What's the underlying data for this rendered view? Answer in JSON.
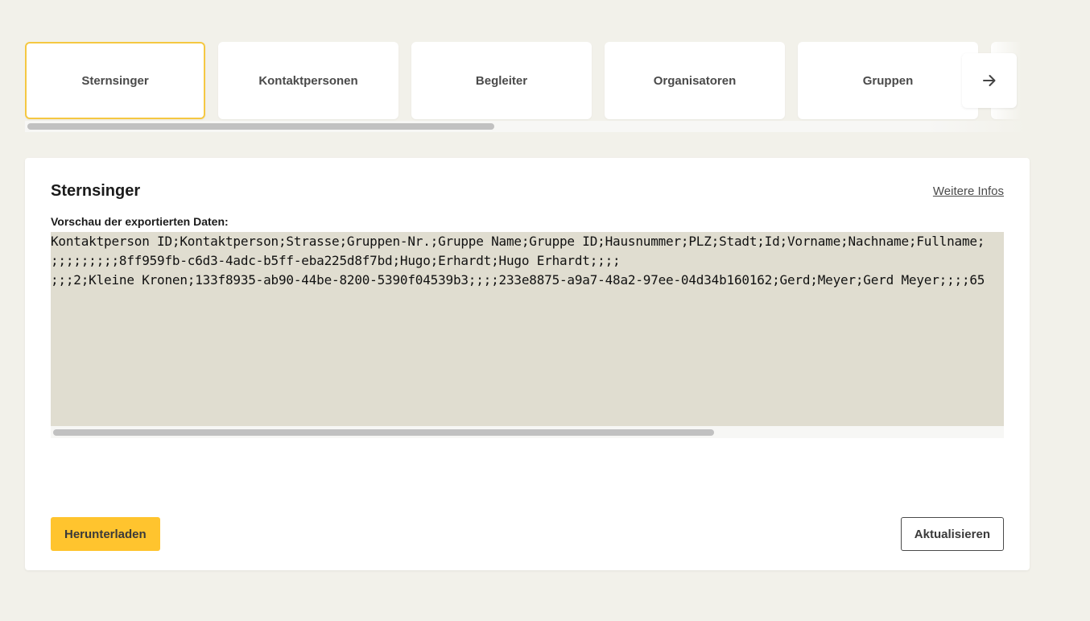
{
  "tabs": [
    {
      "label": "Sternsinger",
      "active": true
    },
    {
      "label": "Kontaktpersonen",
      "active": false
    },
    {
      "label": "Begleiter",
      "active": false
    },
    {
      "label": "Organisatoren",
      "active": false
    },
    {
      "label": "Gruppen",
      "active": false
    }
  ],
  "tabs_next_icon": "arrow-right-icon",
  "card": {
    "title": "Sternsinger",
    "more_link": "Weitere Infos",
    "preview_label": "Vorschau der exportierten Daten:",
    "preview_lines": [
      "Kontaktperson ID;Kontaktperson;Strasse;Gruppen-Nr.;Gruppe Name;Gruppe ID;Hausnummer;PLZ;Stadt;Id;Vorname;Nachname;Fullname;",
      ";;;;;;;;;8ff959fb-c6d3-4adc-b5ff-eba225d8f7bd;Hugo;Erhardt;Hugo Erhardt;;;;",
      ";;;2;Kleine Kronen;133f8935-ab90-44be-8200-5390f04539b3;;;;233e8875-a9a7-48a2-97ee-04d34b160162;Gerd;Meyer;Gerd Meyer;;;;65"
    ],
    "download_label": "Herunterladen",
    "refresh_label": "Aktualisieren"
  },
  "colors": {
    "background": "#f2f1ea",
    "accent": "#ffc42e",
    "active_tab_border": "#f5c842",
    "preview_bg": "#e0ddd0"
  }
}
